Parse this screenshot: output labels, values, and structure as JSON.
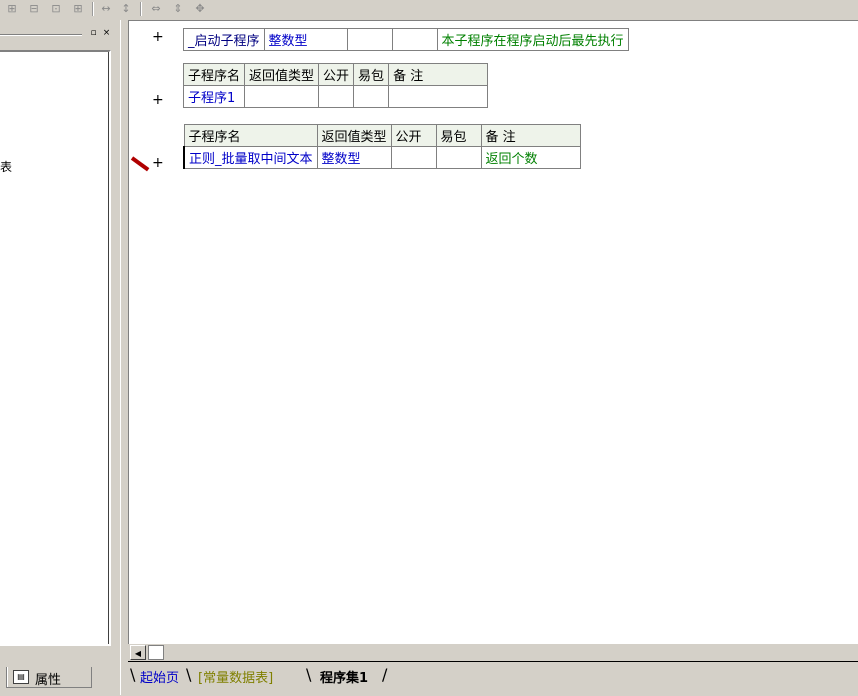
{
  "toolbar": {
    "icons": [
      "align-left-icon",
      "align-center-icon",
      "align-right-icon",
      "align-top-icon",
      "space-horizontal-icon",
      "space-vertical-icon",
      "same-width-icon",
      "same-height-icon",
      "same-size-icon"
    ]
  },
  "left_panel": {
    "partial_text": "表",
    "restore_glyph": "▫",
    "close_glyph": "×",
    "properties_tab_label": "属性"
  },
  "editor": {
    "startup_row": {
      "plus": "+",
      "name": "_启动子程序",
      "return_type": "整数型",
      "remark": "本子程序在程序启动后最先执行"
    },
    "sub1_table": {
      "headers": [
        "子程序名",
        "返回值类型",
        "公开",
        "易包",
        "备 注"
      ],
      "plus": "+",
      "name": "子程序1",
      "return_type": "",
      "public": "",
      "epackage": "",
      "remark": ""
    },
    "sub2_table": {
      "headers": [
        "子程序名",
        "返回值类型",
        "公开",
        "易包",
        "备 注"
      ],
      "plus": "+",
      "name": "正则_批量取中间文本",
      "return_type": "整数型",
      "public": "",
      "epackage": "",
      "remark": "返回个数"
    }
  },
  "scrollbar": {
    "left_arrow_glyph": "◀"
  },
  "tabs": [
    {
      "label": "起始页",
      "color": "#0000c8",
      "bold": false
    },
    {
      "label": "[常量数据表]",
      "color": "#808000",
      "bold": false
    },
    {
      "label": "程序集1",
      "color": "#000000",
      "bold": true
    }
  ]
}
